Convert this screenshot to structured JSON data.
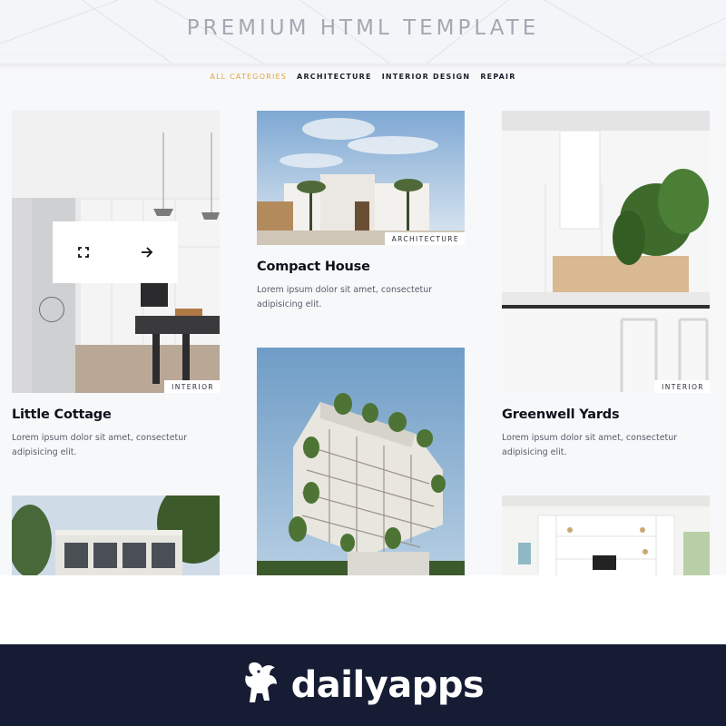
{
  "header": {
    "subtitle": "PREMIUM HTML TEMPLATE"
  },
  "filters": [
    {
      "label": "ALL CATEGORIES",
      "active": true
    },
    {
      "label": "ARCHITECTURE",
      "active": false
    },
    {
      "label": "INTERIOR DESIGN",
      "active": false
    },
    {
      "label": "REPAIR",
      "active": false
    }
  ],
  "colors": {
    "accent": "#e2a33b",
    "footer_bg": "#161c34",
    "page_bg": "#f7f8fa"
  },
  "cards": [
    {
      "title": "Little Cottage",
      "tag": "INTERIOR",
      "desc": "Lorem ipsum dolor sit amet, consectetur adipisicing elit."
    },
    {
      "title": "Compact House",
      "tag": "ARCHITECTURE",
      "desc": "Lorem ipsum dolor sit amet, consectetur adipisicing elit."
    },
    {
      "title": "Greenwell Yards",
      "tag": "INTERIOR",
      "desc": "Lorem ipsum dolor sit amet, consectetur adipisicing elit."
    }
  ],
  "overlay": {
    "icons": [
      "expand-icon",
      "arrow-right-icon"
    ]
  },
  "footer": {
    "brand": "dailyapps",
    "logo_icon": "griffin-logo-icon"
  }
}
